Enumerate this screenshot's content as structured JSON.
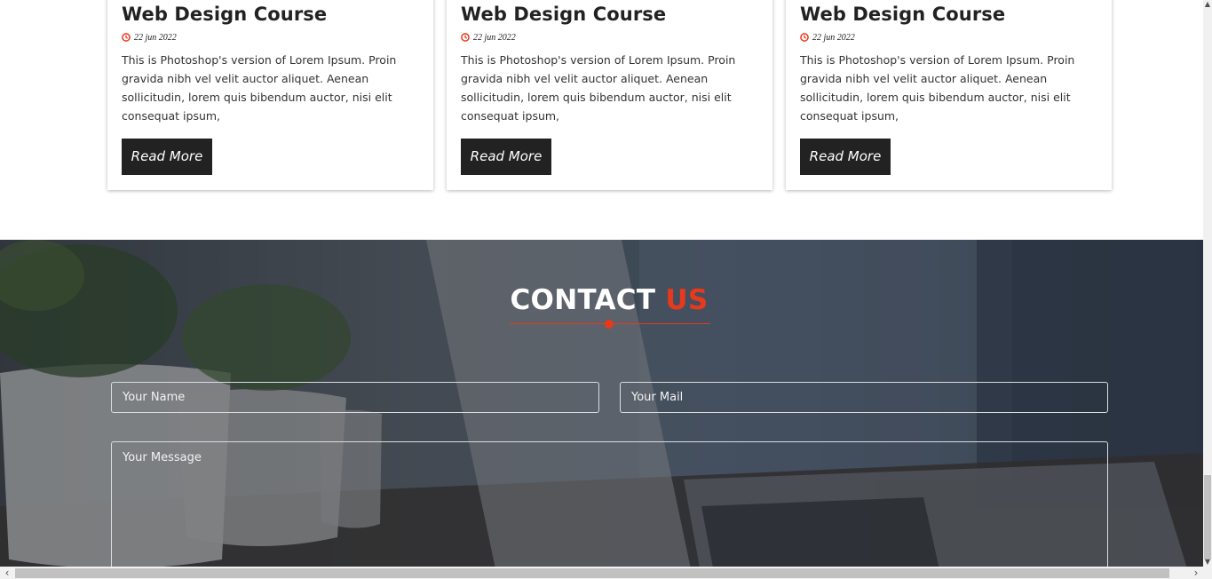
{
  "cards": [
    {
      "title": "Web Design Course",
      "date": "22 jun 2022",
      "text": "This is Photoshop's version of Lorem Ipsum. Proin gravida nibh vel velit auctor aliquet. Aenean sollicitudin, lorem quis bibendum auctor, nisi elit consequat ipsum,",
      "button": "Read More"
    },
    {
      "title": "Web Design Course",
      "date": "22 jun 2022",
      "text": "This is Photoshop's version of Lorem Ipsum. Proin gravida nibh vel velit auctor aliquet. Aenean sollicitudin, lorem quis bibendum auctor, nisi elit consequat ipsum,",
      "button": "Read More"
    },
    {
      "title": "Web Design Course",
      "date": "22 jun 2022",
      "text": "This is Photoshop's version of Lorem Ipsum. Proin gravida nibh vel velit auctor aliquet. Aenean sollicitudin, lorem quis bibendum auctor, nisi elit consequat ipsum,",
      "button": "Read More"
    }
  ],
  "contact": {
    "title_main": "CONTACT",
    "title_accent": "US",
    "name_placeholder": "Your Name",
    "mail_placeholder": "Your Mail",
    "message_placeholder": "Your Message"
  },
  "colors": {
    "accent": "#e8391d",
    "button_bg": "#222222",
    "text_dark": "#222222"
  },
  "icons": {
    "date": "clock-icon",
    "scroll_up": "arrow-up-icon",
    "scroll_down": "arrow-down-icon",
    "scroll_left": "arrow-left-icon",
    "scroll_right": "arrow-right-icon"
  }
}
